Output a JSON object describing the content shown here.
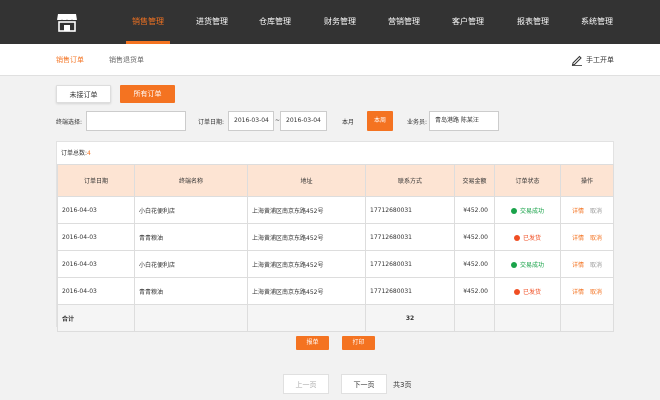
{
  "nav": {
    "items": [
      "销售管理",
      "进货管理",
      "仓库管理",
      "财务管理",
      "营销管理",
      "客户管理",
      "报表管理",
      "系统管理"
    ],
    "active_index": 0
  },
  "subnav": {
    "tabs": [
      "销售订单",
      "销售退货单"
    ],
    "active_index": 0,
    "manual_label": "手工开单"
  },
  "toolbar": {
    "pending_label": "未接订单",
    "all_label": "所有订单"
  },
  "filters": {
    "terminal_label": "终端选择:",
    "terminal_value": "",
    "date_label": "订单日期:",
    "date_from": "2016-03-04",
    "date_sep": "~",
    "date_to": "2016-03-04",
    "month_label": "本月",
    "week_label": "本周",
    "salesman_label": "业务员:",
    "salesman_value": "青岛港路 陈某汪"
  },
  "summary": {
    "label": "订单总数:",
    "count": "4"
  },
  "table": {
    "headers": [
      "订单日期",
      "终端名称",
      "地址",
      "联系方式",
      "交易金额",
      "订单状态",
      "操作"
    ],
    "rows": [
      {
        "date": "2016-04-03",
        "name": "小白花便利店",
        "address": "上海黄浦区南京东路452号",
        "phone": "17712680031",
        "amount": "¥452.00",
        "status": "交易成功",
        "status_color": "#1aa34a",
        "ops": [
          "详情",
          "取消"
        ]
      },
      {
        "date": "2016-04-03",
        "name": "青青粮油",
        "address": "上海黄浦区南京东路452号",
        "phone": "17712680031",
        "amount": "¥452.00",
        "status": "已发货",
        "status_color": "#f04e23",
        "ops": [
          "详情",
          "取消"
        ]
      },
      {
        "date": "2016-04-03",
        "name": "小白花便利店",
        "address": "上海黄浦区南京东路452号",
        "phone": "17712680031",
        "amount": "¥452.00",
        "status": "交易成功",
        "status_color": "#1aa34a",
        "ops": [
          "详情",
          "取消"
        ]
      },
      {
        "date": "2016-04-03",
        "name": "青青粮油",
        "address": "上海黄浦区南京东路452号",
        "phone": "17712680031",
        "amount": "¥452.00",
        "status": "已发货",
        "status_color": "#f04e23",
        "ops": [
          "详情",
          "取消"
        ]
      }
    ],
    "sum_label": "合计",
    "sum_value": "32"
  },
  "actions": {
    "report_label": "报单",
    "print_label": "打印"
  },
  "pager": {
    "prev_label": "上一页",
    "next_label": "下一页",
    "total_label": "共3页"
  },
  "icons": {
    "logo": "store-icon",
    "manual": "pen-icon"
  },
  "colors": {
    "accent": "#f47321",
    "topbar": "#333333",
    "header_row": "#fde4d3"
  }
}
